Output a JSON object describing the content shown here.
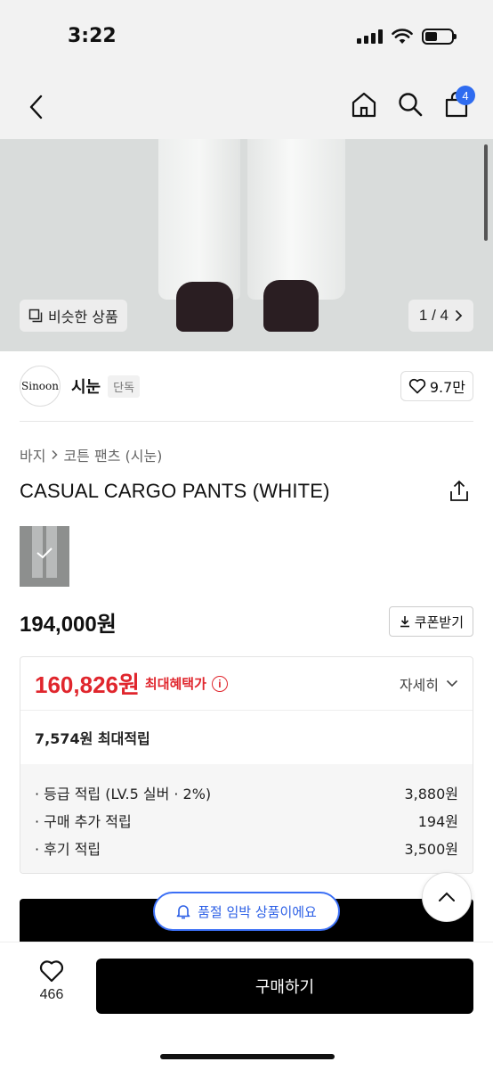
{
  "status_bar": {
    "time": "3:22"
  },
  "nav": {
    "cart_count": "4"
  },
  "hero": {
    "similar_label": "비슷한 상품",
    "page_indicator": "1 / 4"
  },
  "brand": {
    "logo_text": "Sinoon",
    "name": "시눈",
    "tag": "단독",
    "likes": "9.7만"
  },
  "breadcrumb": {
    "category": "바지",
    "subcategory": "코튼 팬츠 (시눈)"
  },
  "product": {
    "title": "CASUAL CARGO PANTS (WHITE)",
    "price": "194,000원"
  },
  "coupon": {
    "label": "쿠폰받기"
  },
  "benefit": {
    "best_price": "160,826원",
    "best_label": "최대혜택가",
    "detail_label": "자세히",
    "points_summary": "7,574원 최대적립",
    "points": [
      {
        "label": "· 등급 적립 (LV.5 실버 · 2%)",
        "value": "3,880원"
      },
      {
        "label": "· 구매 추가 적립",
        "value": "194원"
      },
      {
        "label": "· 후기 적립",
        "value": "3,500원"
      }
    ]
  },
  "toast": {
    "label": "품절 임박 상품이에요"
  },
  "bottom": {
    "wish_count": "466",
    "buy_label": "구매하기"
  },
  "colors": {
    "accent_red": "#e0262d",
    "accent_blue": "#2f6cf0"
  }
}
